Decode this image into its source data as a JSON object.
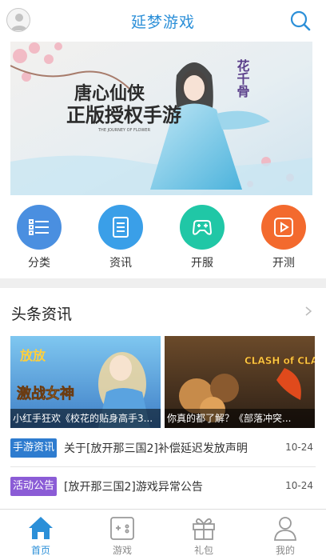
{
  "header": {
    "title": "延梦游戏",
    "avatar_icon": "user-avatar-icon",
    "search_icon": "search-icon"
  },
  "banner": {
    "calligraphy": [
      "唐心仙侠",
      "正版授权手游"
    ],
    "subtitle": "THE JOURNEY OF FLOWER",
    "logo_text": "花千骨"
  },
  "nav": [
    {
      "label": "分类",
      "icon": "list-icon",
      "color": "#4a8fe0"
    },
    {
      "label": "资讯",
      "icon": "document-icon",
      "color": "#3a9fe8"
    },
    {
      "label": "开服",
      "icon": "gamepad-icon",
      "color": "#20c7a6"
    },
    {
      "label": "开测",
      "icon": "play-icon",
      "color": "#f36a2e"
    }
  ],
  "section": {
    "title": "头条资讯"
  },
  "cards": [
    {
      "caption": "小红手狂欢《校花的贴身高手3...",
      "art_text": "激战女神"
    },
    {
      "caption": "你真的都了解？《部落冲突...",
      "art_text": "CLASH of CLANS"
    }
  ],
  "news": [
    {
      "tag": "手游资讯",
      "tag_color": "#2e7ccf",
      "title": "关于[放开那三国2]补偿延迟发放声明",
      "date": "10-24"
    },
    {
      "tag": "活动公告",
      "tag_color": "#8b5cd6",
      "title": "[放开那三国2]游戏异常公告",
      "date": "10-24"
    }
  ],
  "tabs": [
    {
      "label": "首页",
      "icon": "home-icon",
      "active": true
    },
    {
      "label": "游戏",
      "icon": "game-controller-icon",
      "active": false
    },
    {
      "label": "礼包",
      "icon": "gift-icon",
      "active": false
    },
    {
      "label": "我的",
      "icon": "profile-icon",
      "active": false
    }
  ]
}
